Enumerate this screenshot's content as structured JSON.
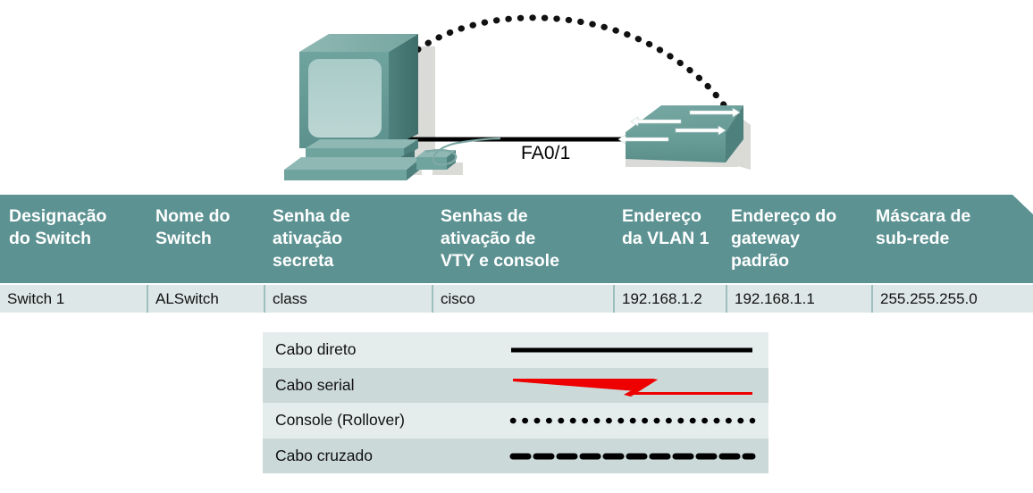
{
  "topology": {
    "pc": {
      "name": "pc-workstation"
    },
    "switch": {
      "name": "network-switch"
    },
    "interface_label": "FA0/1",
    "straight_cable": {
      "name": "straight-cable",
      "color": "#000000"
    },
    "console_cable": {
      "name": "console-rollover-cable",
      "color": "#000000",
      "style": "dotted"
    }
  },
  "table": {
    "headers": [
      [
        "Designação",
        "do Switch"
      ],
      [
        "Nome do",
        "Switch"
      ],
      [
        "Senha de",
        "ativação",
        "secreta"
      ],
      [
        "Senhas de",
        "ativação de",
        "VTY e console"
      ],
      [
        "Endereço",
        "da VLAN 1"
      ],
      [
        "Endereço do",
        "gateway",
        "padrão"
      ],
      [
        "Máscara de",
        "sub-rede"
      ]
    ],
    "rows": [
      [
        "Switch 1",
        "ALSwitch",
        "class",
        "cisco",
        "192.168.1.2",
        "192.168.1.1",
        "255.255.255.0"
      ]
    ],
    "header_color": "#5d9292",
    "row_color": "#dde7e7"
  },
  "legend": {
    "items": [
      {
        "label": "Cabo direto",
        "style": "solid",
        "color": "#000000"
      },
      {
        "label": "Cabo serial",
        "style": "serial-z",
        "color": "#ee0000"
      },
      {
        "label": "Console (Rollover)",
        "style": "dotted",
        "color": "#000000"
      },
      {
        "label": "Cabo cruzado",
        "style": "dashed",
        "color": "#000000"
      }
    ],
    "row_colors": [
      "#e4ecec",
      "#ccd9d9"
    ]
  }
}
